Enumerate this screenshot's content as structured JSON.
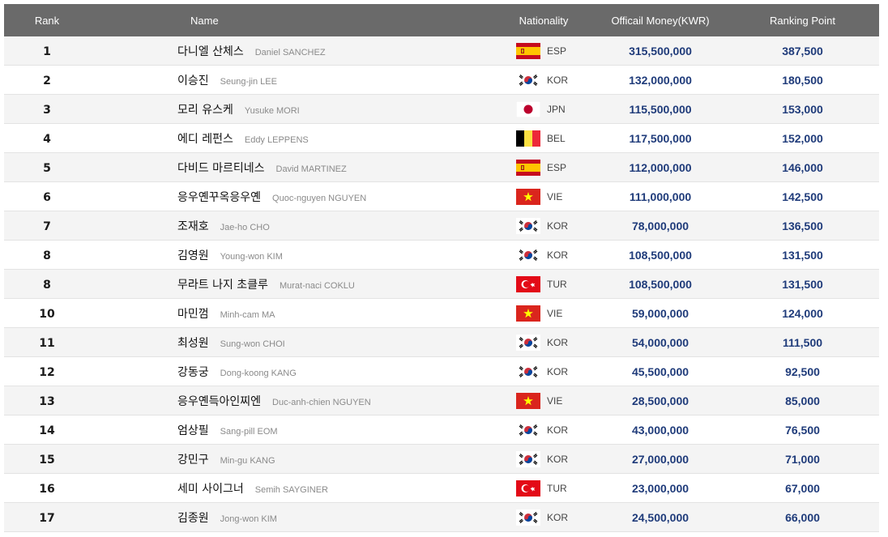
{
  "header": {
    "rank": "Rank",
    "name": "Name",
    "nationality": "Nationality",
    "money": "Officail Money(KWR)",
    "point": "Ranking Point"
  },
  "rows": [
    {
      "rank": "1",
      "kname": "다니엘 산체스",
      "ename": "Daniel SANCHEZ",
      "flag": "esp-flag-icon",
      "code": "ESP",
      "money": "315,500,000",
      "point": "387,500"
    },
    {
      "rank": "2",
      "kname": "이승진",
      "ename": "Seung-jin LEE",
      "flag": "kor-flag-icon",
      "code": "KOR",
      "money": "132,000,000",
      "point": "180,500"
    },
    {
      "rank": "3",
      "kname": "모리 유스케",
      "ename": "Yusuke MORI",
      "flag": "jpn-flag-icon",
      "code": "JPN",
      "money": "115,500,000",
      "point": "153,000"
    },
    {
      "rank": "4",
      "kname": "에디 레펀스",
      "ename": "Eddy LEPPENS",
      "flag": "bel-flag-icon",
      "code": "BEL",
      "money": "117,500,000",
      "point": "152,000"
    },
    {
      "rank": "5",
      "kname": "다비드 마르티네스",
      "ename": "David MARTINEZ",
      "flag": "esp-flag-icon",
      "code": "ESP",
      "money": "112,000,000",
      "point": "146,000"
    },
    {
      "rank": "6",
      "kname": "응우옌꾸옥응우옌",
      "ename": "Quoc-nguyen NGUYEN",
      "flag": "vie-flag-icon",
      "code": "VIE",
      "money": "111,000,000",
      "point": "142,500"
    },
    {
      "rank": "7",
      "kname": "조재호",
      "ename": "Jae-ho CHO",
      "flag": "kor-flag-icon",
      "code": "KOR",
      "money": "78,000,000",
      "point": "136,500"
    },
    {
      "rank": "8",
      "kname": "김영원",
      "ename": "Young-won KIM",
      "flag": "kor-flag-icon",
      "code": "KOR",
      "money": "108,500,000",
      "point": "131,500"
    },
    {
      "rank": "8",
      "kname": "무라트 나지 초클루",
      "ename": "Murat-naci COKLU",
      "flag": "tur-flag-icon",
      "code": "TUR",
      "money": "108,500,000",
      "point": "131,500"
    },
    {
      "rank": "10",
      "kname": "마민껌",
      "ename": "Minh-cam MA",
      "flag": "vie-flag-icon",
      "code": "VIE",
      "money": "59,000,000",
      "point": "124,000"
    },
    {
      "rank": "11",
      "kname": "최성원",
      "ename": "Sung-won CHOI",
      "flag": "kor-flag-icon",
      "code": "KOR",
      "money": "54,000,000",
      "point": "111,500"
    },
    {
      "rank": "12",
      "kname": "강동궁",
      "ename": "Dong-koong KANG",
      "flag": "kor-flag-icon",
      "code": "KOR",
      "money": "45,500,000",
      "point": "92,500"
    },
    {
      "rank": "13",
      "kname": "응우옌득아인찌엔",
      "ename": "Duc-anh-chien NGUYEN",
      "flag": "vie-flag-icon",
      "code": "VIE",
      "money": "28,500,000",
      "point": "85,000"
    },
    {
      "rank": "14",
      "kname": "엄상필",
      "ename": "Sang-pill EOM",
      "flag": "kor-flag-icon",
      "code": "KOR",
      "money": "43,000,000",
      "point": "76,500"
    },
    {
      "rank": "15",
      "kname": "강민구",
      "ename": "Min-gu KANG",
      "flag": "kor-flag-icon",
      "code": "KOR",
      "money": "27,000,000",
      "point": "71,000"
    },
    {
      "rank": "16",
      "kname": "세미 사이그너",
      "ename": "Semih SAYGINER",
      "flag": "tur-flag-icon",
      "code": "TUR",
      "money": "23,000,000",
      "point": "67,000"
    },
    {
      "rank": "17",
      "kname": "김종원",
      "ename": "Jong-won KIM",
      "flag": "kor-flag-icon",
      "code": "KOR",
      "money": "24,500,000",
      "point": "66,000"
    }
  ],
  "colors": {
    "header_bg": "#6a6a6a",
    "number_text": "#1f3b7a",
    "row_alt": "#f4f4f4"
  }
}
